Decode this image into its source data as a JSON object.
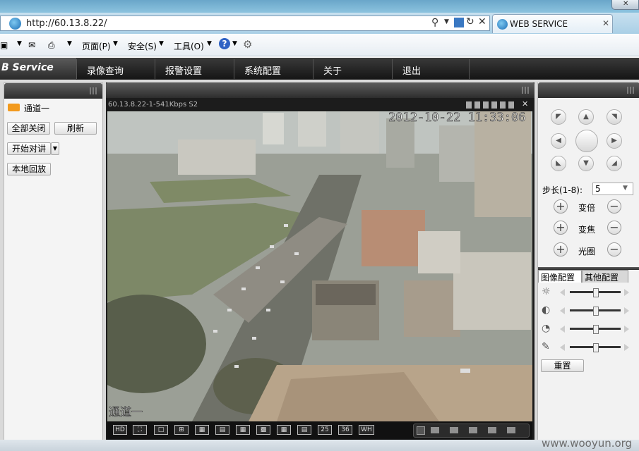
{
  "browser": {
    "url": "http://60.13.8.22/",
    "tab_title": "WEB SERVICE",
    "commands": {
      "page": "页面(P)",
      "safety": "安全(S)",
      "tools": "工具(O)"
    }
  },
  "app": {
    "logo": "B Service",
    "nav": [
      "录像查询",
      "报警设置",
      "系统配置",
      "关于",
      "退出"
    ]
  },
  "left_panel": {
    "channel_label": "通道一",
    "buttons": {
      "close_all": "全部关闭",
      "refresh": "刷新",
      "start_talk": "开始对讲",
      "local_playback": "本地回放"
    }
  },
  "video": {
    "stream_info": "60.13.8.22-1-541Kbps S2",
    "timestamp": "2012-10-22 11:33:06",
    "channel_osd": "通道一",
    "toolbar": [
      "HD",
      "",
      "",
      "",
      "",
      "",
      "",
      "",
      "",
      "",
      "25",
      "36",
      "WH"
    ]
  },
  "ptz": {
    "step_label": "步长(1-8):",
    "step_value": "5",
    "zoom_label": "变倍",
    "focus_label": "变焦",
    "iris_label": "光圈",
    "tabs": [
      "图像配置",
      "其他配置"
    ],
    "reset_label": "重置",
    "sliders": [
      0.5,
      0.5,
      0.5,
      0.5
    ]
  },
  "watermark": "www.wooyun.org",
  "colors": {
    "nav_bg": "#1e1e1e",
    "browser_blue": "#8cc3df"
  }
}
